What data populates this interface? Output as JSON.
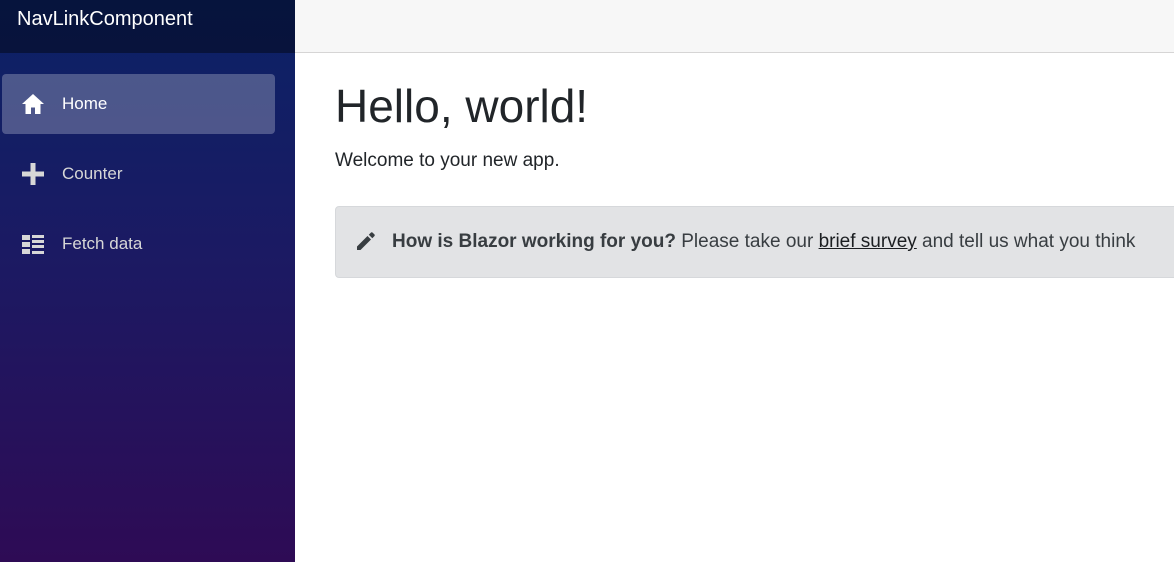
{
  "brand": "NavLinkComponent",
  "nav": {
    "items": [
      {
        "label": "Home",
        "icon": "home-icon",
        "active": true
      },
      {
        "label": "Counter",
        "icon": "plus-icon",
        "active": false
      },
      {
        "label": "Fetch data",
        "icon": "list-icon",
        "active": false
      }
    ]
  },
  "main": {
    "title": "Hello, world!",
    "welcome": "Welcome to your new app."
  },
  "survey": {
    "icon": "pencil-icon",
    "question": "How is Blazor working for you?",
    "text_before": " Please take our ",
    "link_text": "brief survey",
    "text_after": " and tell us what you think"
  },
  "colors": {
    "sidebar_top": "#0b2266",
    "sidebar_bottom": "#2e0b55",
    "alert_bg": "#e2e3e5"
  }
}
